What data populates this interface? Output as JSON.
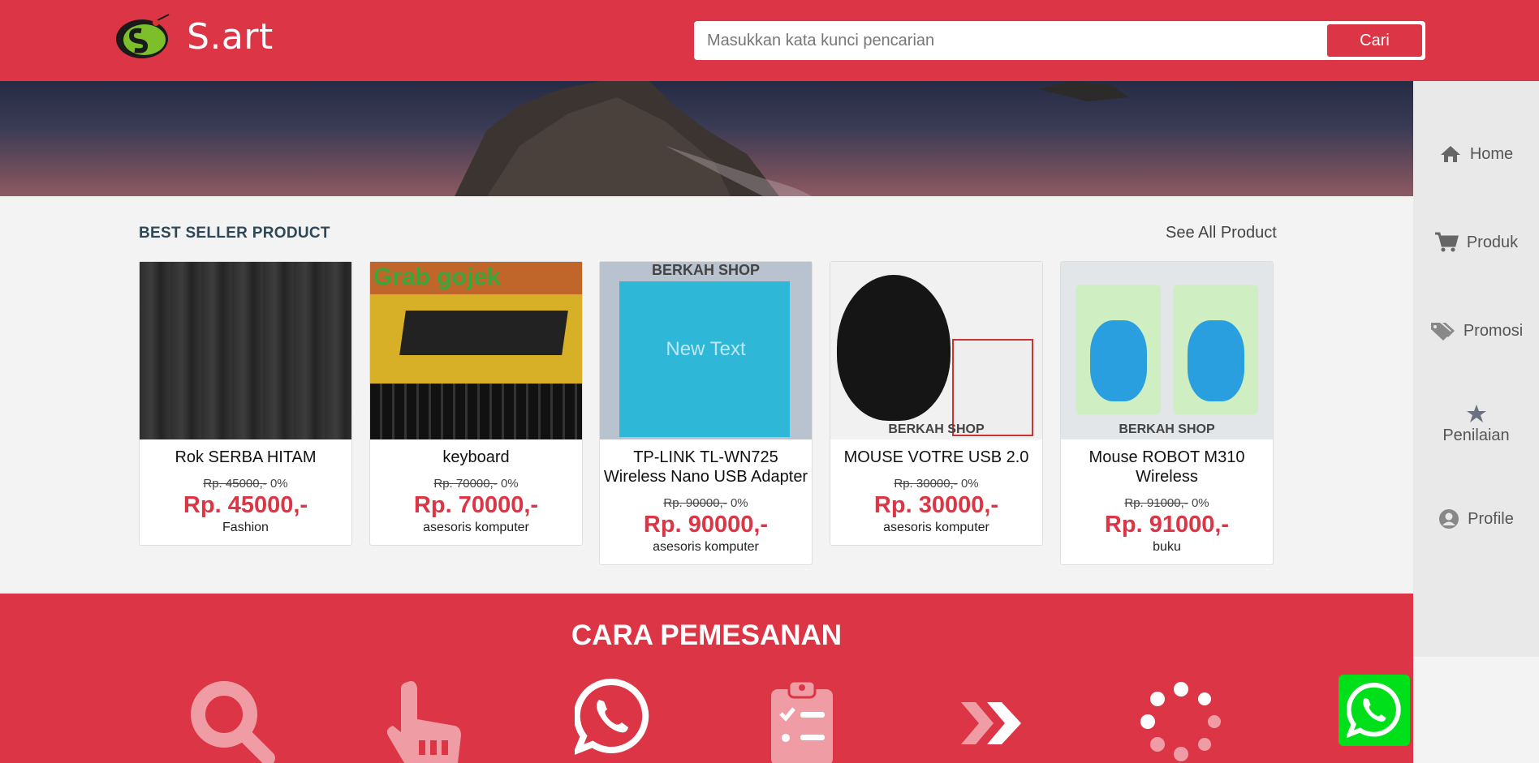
{
  "header": {
    "logo_text": "S.art",
    "logo_mark_text": "S.art",
    "search_placeholder": "Masukkan kata kunci pencarian",
    "search_button": "Cari"
  },
  "sidebar": {
    "items": [
      {
        "label": "Home",
        "icon": "home-icon"
      },
      {
        "label": "Produk",
        "icon": "cart-icon"
      },
      {
        "label": "Promosi",
        "icon": "tags-icon"
      },
      {
        "label": "Penilaian",
        "icon": "star-icon"
      },
      {
        "label": "Profile",
        "icon": "user-circle-icon"
      }
    ]
  },
  "best_seller": {
    "title": "BEST SELLER PRODUCT",
    "see_all": "See All Product",
    "products": [
      {
        "name": "Rok SERBA HITAM",
        "old_price": "Rp. 45000,-",
        "discount": "0%",
        "price": "Rp. 45000,-",
        "category": "Fashion",
        "image_text": ""
      },
      {
        "name": "keyboard",
        "old_price": "Rp. 70000,-",
        "discount": "0%",
        "price": "Rp. 70000,-",
        "category": "asesoris komputer",
        "image_text": "Grab gojek"
      },
      {
        "name": "TP-LINK TL-WN725 Wireless Nano USB Adapter",
        "old_price": "Rp. 90000,-",
        "discount": "0%",
        "price": "Rp. 90000,-",
        "category": "asesoris komputer",
        "image_text": "BERKAH SHOP",
        "overlay_text": "New Text"
      },
      {
        "name": "MOUSE VOTRE USB 2.0",
        "old_price": "Rp. 30000,-",
        "discount": "0%",
        "price": "Rp. 30000,-",
        "category": "asesoris komputer",
        "image_text": "BERKAH SHOP"
      },
      {
        "name": "Mouse ROBOT M310 Wireless",
        "old_price": "Rp. 91000,-",
        "discount": "0%",
        "price": "Rp. 91000,-",
        "category": "buku",
        "image_text": "BERKAH SHOP"
      }
    ]
  },
  "order": {
    "title": "CARA PEMESANAN",
    "steps": [
      "search-icon",
      "hand-pointer-icon",
      "whatsapp-icon",
      "clipboard-list-icon",
      "double-chevron-right-icon",
      "spinner-icon"
    ]
  },
  "colors": {
    "primary": "#dc3545",
    "whatsapp": "#00e01a",
    "sidebar_bg": "#e9e9e9"
  }
}
